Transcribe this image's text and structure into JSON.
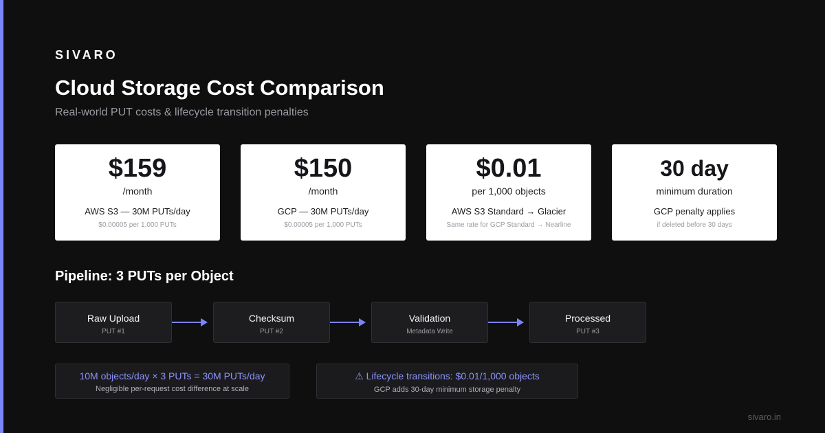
{
  "brand": "SIVARO",
  "title": "Cloud Storage Cost Comparison",
  "subtitle": "Real-world PUT costs & lifecycle transition penalties",
  "cards": [
    {
      "value": "$159",
      "unit": "/month",
      "desc": "AWS S3 — 30M PUTs/day",
      "note": "$0.00005 per 1,000 PUTs"
    },
    {
      "value": "$150",
      "unit": "/month",
      "desc": "GCP — 30M PUTs/day",
      "note": "$0.00005 per 1,000 PUTs"
    },
    {
      "value": "$0.01",
      "unit": "per 1,000 objects",
      "desc": "AWS S3 Standard → Glacier",
      "note": "Same rate for GCP Standard → Nearline"
    },
    {
      "value": "30 day",
      "unit": "minimum duration",
      "desc": "GCP penalty applies",
      "note": "if deleted before 30 days"
    }
  ],
  "pipeline": {
    "title": "Pipeline: 3 PUTs per Object",
    "steps": [
      {
        "name": "Raw Upload",
        "sub": "PUT #1"
      },
      {
        "name": "Checksum",
        "sub": "PUT #2"
      },
      {
        "name": "Validation",
        "sub": "Metadata Write"
      },
      {
        "name": "Processed",
        "sub": "PUT #3"
      }
    ]
  },
  "info": [
    {
      "highlight": "10M objects/day × 3 PUTs = 30M PUTs/day",
      "text": "Negligible per-request cost difference at scale"
    },
    {
      "highlight": "⚠ Lifecycle transitions: $0.01/1,000 objects",
      "text": "GCP adds 30-day minimum storage penalty"
    }
  ],
  "footer": "sivaro.in",
  "colors": {
    "accent": "#7b85f5",
    "background": "#0f0f10",
    "card": "#ffffff"
  }
}
